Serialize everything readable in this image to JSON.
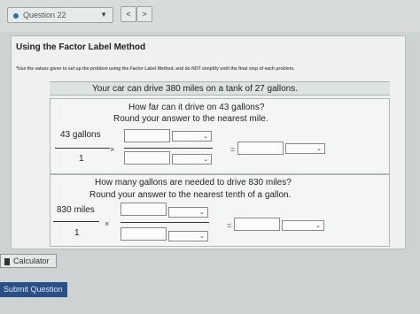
{
  "nav": {
    "question_label": "Question 22",
    "prev_symbol": "<",
    "next_symbol": ">"
  },
  "panel": {
    "title": "Using the Factor Label Method",
    "note": "*Use the values given to set up the problem using the Factor Label Method, and do NOT simplify until the final step of each problem.",
    "given": "Your car can drive 380 miles on a tank of 27 gallons."
  },
  "problem1": {
    "line1": "How far can it drive on 43 gallons?",
    "line2": "Round your answer to the nearest mile.",
    "numerator": "43 gallons",
    "denominator": "1",
    "times": "×",
    "equals": "="
  },
  "problem2": {
    "line1": "How many gallons are needed to drive 830 miles?",
    "line2": "Round your answer to the nearest tenth of a gallon.",
    "numerator": "830 miles",
    "denominator": "1",
    "times": "×",
    "equals": "="
  },
  "footer": {
    "calculator_label": "Calculator",
    "submit_label": "Submit Question"
  },
  "icons": {
    "dropdown": "chevron-down-icon",
    "calculator": "calculator-icon"
  },
  "colors": {
    "accent": "#2c6ea8",
    "submit_bg": "#2a4f86"
  }
}
